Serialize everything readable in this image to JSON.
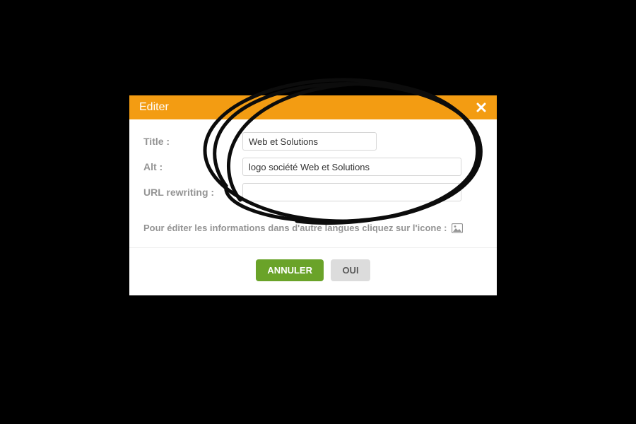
{
  "dialog": {
    "title": "Editer",
    "fields": {
      "title": {
        "label": "Title :",
        "value": "Web et Solutions"
      },
      "alt": {
        "label": "Alt :",
        "value": "logo société Web et Solutions"
      },
      "url_rewriting": {
        "label": "URL rewriting :",
        "value": ""
      }
    },
    "hint": "Pour éditer les informations dans d'autre langues cliquez sur l'icone :",
    "buttons": {
      "cancel": "ANNULER",
      "confirm": "OUI"
    }
  },
  "colors": {
    "header_bg": "#f39c12",
    "cancel_btn": "#6aa329",
    "confirm_btn": "#dcdcdc"
  }
}
